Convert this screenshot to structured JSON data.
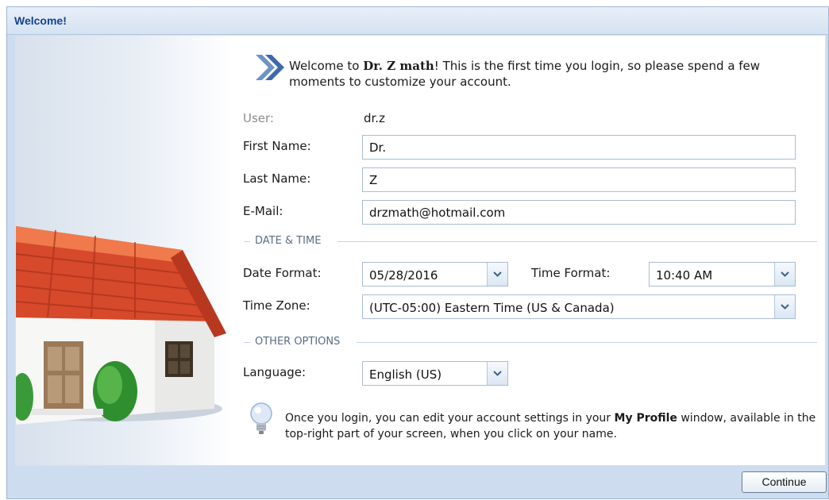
{
  "window": {
    "title": "Welcome!"
  },
  "intro": {
    "prefix": "Welcome to ",
    "brand": "Dr. Z math",
    "suffix": "! This is the first time you login, so please spend a few moments to customize your account."
  },
  "account": {
    "user_label": "User:",
    "user_value": "dr.z",
    "first_name_label": "First Name:",
    "first_name_value": "Dr.",
    "last_name_label": "Last Name:",
    "last_name_value": "Z",
    "email_label": "E-Mail:",
    "email_value": "drzmath@hotmail.com"
  },
  "date_time": {
    "section_title": "DATE & TIME",
    "date_format_label": "Date Format:",
    "date_format_value": "05/28/2016",
    "time_format_label": "Time Format:",
    "time_format_value": "10:40 AM",
    "time_zone_label": "Time Zone:",
    "time_zone_value": "(UTC-05:00) Eastern Time (US & Canada)"
  },
  "other_options": {
    "section_title": "OTHER OPTIONS",
    "language_label": "Language:",
    "language_value": "English (US)"
  },
  "info": {
    "prefix": "Once you login, you can edit your account settings in your ",
    "bold": "My Profile",
    "suffix": " window, available in the top-right part of your screen, when you click on your name."
  },
  "footer": {
    "continue_label": "Continue"
  },
  "icons": [
    "double-chevron-icon",
    "house-illustration",
    "lightbulb-icon",
    "chevron-down-icon"
  ]
}
